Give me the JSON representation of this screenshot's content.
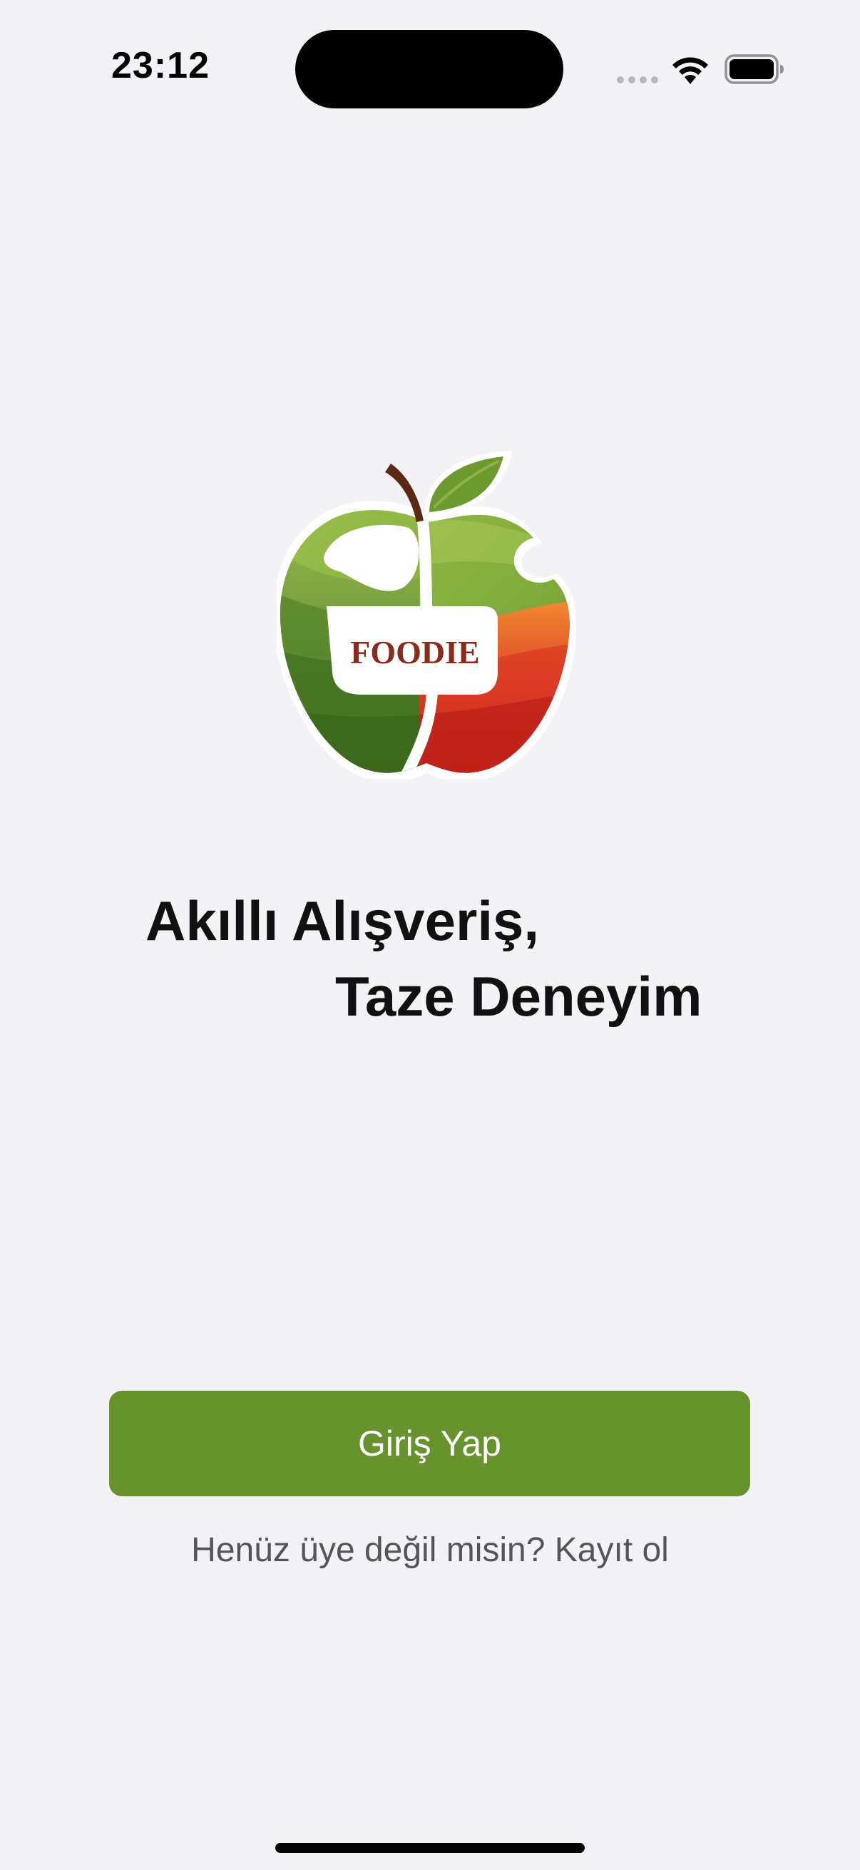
{
  "status_bar": {
    "time": "23:12",
    "icons": [
      "cellular-signal-icon",
      "wifi-icon",
      "battery-icon"
    ]
  },
  "logo": {
    "brand_text": "FOODIE",
    "icon": "apple-logo-icon"
  },
  "headline": {
    "line1": "Akıllı Alışveriş,",
    "line2": "Taze Deneyim"
  },
  "login_button": {
    "label": "Giriş Yap"
  },
  "register_prompt": {
    "question": "Henüz üye değil misin?",
    "link": "Kayıt ol"
  },
  "colors": {
    "background": "#f2f2f7",
    "primary_green": "#67922d",
    "logo_red": "#cc2a1a",
    "logo_orange": "#f08a30",
    "brand_text": "#8a2b1c"
  }
}
